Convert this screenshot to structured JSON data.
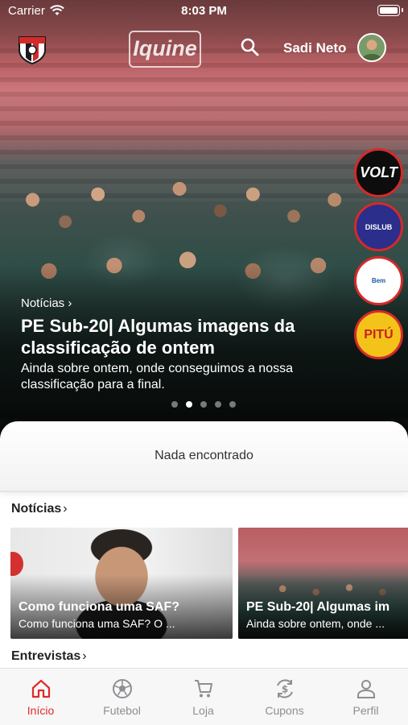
{
  "status_bar": {
    "carrier": "Carrier",
    "time": "8:03 PM"
  },
  "header": {
    "club_logo_icon": "club-crest-icon",
    "sponsor_sign": "Iquine",
    "user_name": "Sadi Neto"
  },
  "partners": [
    {
      "name": "VOLT",
      "icon": "volt-logo"
    },
    {
      "name": "DISLUB",
      "icon": "dislub-logo"
    },
    {
      "name": "Bem",
      "icon": "bem-logo"
    },
    {
      "name": "PITÚ",
      "icon": "pitu-logo"
    }
  ],
  "hero": {
    "category": "Notícias",
    "title": "PE Sub-20| Algumas imagens da classificação de ontem",
    "description": "Ainda sobre ontem, onde conseguimos a nossa classificação para a final.",
    "slides": 5,
    "active_slide": 2
  },
  "sheet": {
    "empty_text": "Nada encontrado"
  },
  "sections": {
    "news_title": "Notícias",
    "news": [
      {
        "title": "Como funciona uma SAF?",
        "description": "Como funciona uma SAF? O ..."
      },
      {
        "title": "PE Sub-20| Algumas im",
        "description": "Ainda sobre ontem, onde ..."
      }
    ],
    "interviews_title": "Entrevistas"
  },
  "tabbar": {
    "tabs": [
      {
        "label": "Início",
        "icon": "home-icon",
        "active": true
      },
      {
        "label": "Futebol",
        "icon": "soccer-ball-icon",
        "active": false
      },
      {
        "label": "Loja",
        "icon": "cart-icon",
        "active": false
      },
      {
        "label": "Cupons",
        "icon": "coupon-icon",
        "active": false
      },
      {
        "label": "Perfil",
        "icon": "profile-icon",
        "active": false
      }
    ]
  },
  "colors": {
    "accent": "#e02a2a",
    "inactive": "#8e8e93"
  }
}
